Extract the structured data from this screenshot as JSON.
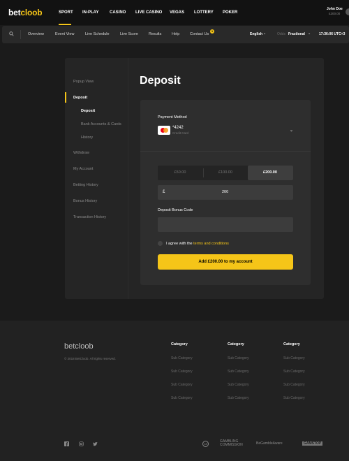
{
  "brand": {
    "logo_main": "bet",
    "logo_accent": "cloob"
  },
  "nav": {
    "items": [
      "SPORT",
      "IN-PLAY",
      "CASINO",
      "LIVE CASINO",
      "VEGAS",
      "LOTTERY",
      "POKER"
    ],
    "active": "SPORT"
  },
  "user": {
    "name": "John Doe",
    "balance": "£200.00"
  },
  "subnav": {
    "items": [
      "Overview",
      "Event View",
      "Live Schedule",
      "Live Score",
      "Results",
      "Help",
      "Contact Us"
    ],
    "contact_badge": "1",
    "language": "English",
    "odds_label": "Odds",
    "odds_value": "Fractional",
    "clock": "17:36:06",
    "timezone": "UTC+3"
  },
  "sidebar": {
    "items": [
      "Popup View",
      "Deposit",
      "Withdraw",
      "My Account",
      "Betting History",
      "Bonus History",
      "Transaction History"
    ],
    "deposit_sub": [
      "Deposit",
      "Bank Accounts & Cards",
      "History"
    ]
  },
  "page": {
    "title": "Deposit",
    "payment_method_label": "Payment Method",
    "card_number": "*4242",
    "card_type": "Credit Card",
    "amounts": [
      "£50.00",
      "£100.00",
      "£200.00"
    ],
    "selected_amount": "£200.00",
    "currency_symbol": "£",
    "amount_value": "200",
    "bonus_code_label": "Deposit Bonus Code",
    "bonus_code_value": "",
    "agree_text": "I agree with the",
    "agree_link": "terms and conditions",
    "cta_label": "Add £200.00 to my account"
  },
  "footer": {
    "logo": "betcloob",
    "copyright": "© 2018 BetCloob. All rights reserved.",
    "columns": [
      {
        "title": "Category",
        "items": [
          "Sub Category",
          "Sub Category",
          "Sub Category",
          "Sub Category"
        ]
      },
      {
        "title": "Category",
        "items": [
          "Sub Category",
          "Sub Category",
          "Sub Category",
          "Sub Category"
        ]
      },
      {
        "title": "Category",
        "items": [
          "Sub Category",
          "Sub Category",
          "Sub Category",
          "Sub Category"
        ]
      }
    ],
    "social_icons": [
      "facebook-icon",
      "instagram-icon",
      "twitter-icon"
    ],
    "partners": [
      "18",
      "GAMBLING COMMISSION",
      "BeGambleAware",
      "GAMSTOP"
    ]
  },
  "colors": {
    "accent": "#f5c518",
    "background": "#1b1b1b",
    "panel": "#2e2e2e",
    "card": "#252525"
  }
}
